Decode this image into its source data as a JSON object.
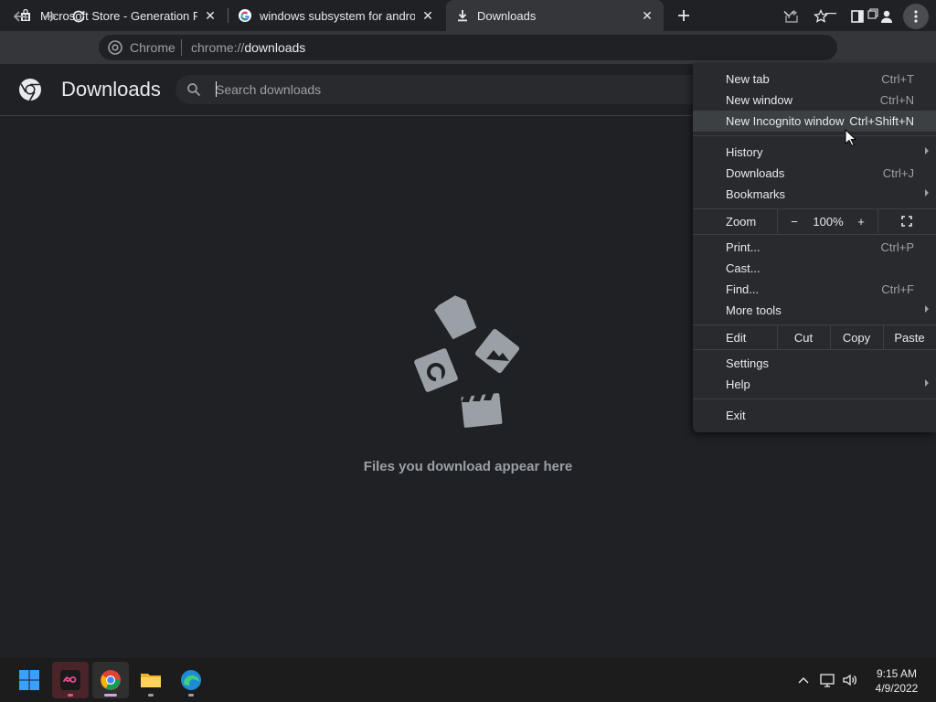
{
  "tabs": [
    {
      "title": "Microsoft Store - Generation Project",
      "icon": "store-icon"
    },
    {
      "title": "windows subsystem for android",
      "icon": "google-icon"
    },
    {
      "title": "Downloads",
      "icon": "download-icon",
      "active": true
    }
  ],
  "omnibox": {
    "chip": "Chrome",
    "url_prefix": "chrome://",
    "url_host": "downloads"
  },
  "page": {
    "title": "Downloads",
    "search_placeholder": "Search downloads",
    "empty_message": "Files you download appear here"
  },
  "menu": {
    "new_tab": {
      "label": "New tab",
      "shortcut": "Ctrl+T"
    },
    "new_window": {
      "label": "New window",
      "shortcut": "Ctrl+N"
    },
    "new_incognito": {
      "label": "New Incognito window",
      "shortcut": "Ctrl+Shift+N"
    },
    "history": {
      "label": "History"
    },
    "downloads": {
      "label": "Downloads",
      "shortcut": "Ctrl+J"
    },
    "bookmarks": {
      "label": "Bookmarks"
    },
    "zoom": {
      "label": "Zoom",
      "minus": "−",
      "value": "100%",
      "plus": "+"
    },
    "print": {
      "label": "Print...",
      "shortcut": "Ctrl+P"
    },
    "cast": {
      "label": "Cast..."
    },
    "find": {
      "label": "Find...",
      "shortcut": "Ctrl+F"
    },
    "more_tools": {
      "label": "More tools"
    },
    "edit": {
      "label": "Edit",
      "cut": "Cut",
      "copy": "Copy",
      "paste": "Paste"
    },
    "settings": {
      "label": "Settings"
    },
    "help": {
      "label": "Help"
    },
    "exit": {
      "label": "Exit"
    }
  },
  "taskbar": {
    "time": "9:15 AM",
    "date": "4/9/2022"
  },
  "colors": {
    "background": "#202124",
    "toolbar": "#35363a",
    "menu": "#292a2d",
    "menu_highlight": "#3c4043",
    "text": "#e8eaed",
    "muted": "#9aa0a6"
  }
}
